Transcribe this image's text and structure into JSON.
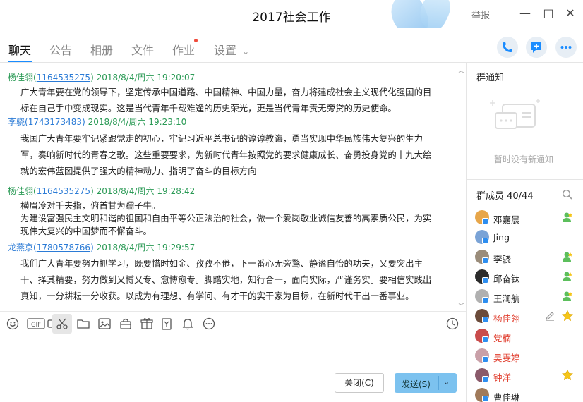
{
  "window": {
    "title": "2017社会工作",
    "report_label": "举报",
    "minimize": "—",
    "maximize": "□",
    "close": "✕"
  },
  "tabs": [
    {
      "label": "聊天",
      "active": true
    },
    {
      "label": "公告"
    },
    {
      "label": "相册"
    },
    {
      "label": "文件"
    },
    {
      "label": "作业",
      "has_dot": true
    },
    {
      "label": "设置"
    }
  ],
  "settings_arrow": "⌄",
  "messages": [
    {
      "sender": "杨佳翎",
      "uid": "1164535275",
      "time": "2018/8/4/周六 19:20:07",
      "color": "#2a9a55",
      "lines": [
        "广大青年要在党的领导下，坚定传承中国道路、中国精神、中国力量，奋力将建成社会主义现代化强国的目",
        "标在自己手中变成现实。这是当代青年千载难逢的历史荣光，更是当代青年责无旁贷的历史使命。"
      ]
    },
    {
      "sender": "李骁",
      "uid": "1743173483",
      "time": "2018/8/4/周六 19:23:10",
      "color": "#2b7bd6",
      "lines": [
        "我国广大青年要牢记紧跟党走的初心，牢记习近平总书记的谆谆教诲，勇当实现中华民族伟大复兴的生力",
        "军，奏响新时代的青春之歌。这些重要要求，为新时代青年按照党的要求健康成长、奋勇投身党的十九大绘",
        "就的宏伟蓝图提供了强大的精神动力、指明了奋斗的目标方向"
      ]
    },
    {
      "sender": "杨佳翎",
      "uid": "1164535275",
      "time": "2018/8/4/周六 19:28:42",
      "color": "#2a9a55",
      "lines": [
        "横眉冷对千夫指，俯首甘为孺子牛。",
        "为建设富强民主文明和谐的祖国和自由平等公正法治的社会，做一个爱岗敬业诚信友善的高素质公民，为实",
        "现伟大复兴的中国梦而不懈奋斗。"
      ]
    },
    {
      "sender": "龙燕京",
      "uid": "1780578766",
      "time": "2018/8/4/周六 19:29:57",
      "color": "#2b7bd6",
      "lines": [
        "我们广大青年要努力抓学习，既要惜时如金、孜孜不倦，下一番心无旁骛、静谧自怡的功夫，又要突出主",
        "干、择其精要，努力做到又博又专、愈博愈专。脚踏实地，知行合一，面向实际，严谨务实。要相信实践出",
        "真知，一分耕耘一分收获。以成为有理想、有学问、有才干的实干家为目标，在新时代干出一番事业。"
      ]
    }
  ],
  "toolbar_icons": [
    "emoji-icon",
    "gif-icon",
    "video-icon",
    "scissors-icon",
    "folder-icon",
    "image-icon",
    "bag-icon",
    "gift-icon",
    "note-icon",
    "bell-icon",
    "more-icon",
    "history-icon"
  ],
  "buttons": {
    "close": "关闭(C)",
    "send": "发送(S)",
    "send_arrow": "⌄"
  },
  "notice": {
    "title": "群通知",
    "empty": "暂时没有新通知"
  },
  "members_panel": {
    "title": "群成员 40/44"
  },
  "members": [
    {
      "name": "邓嘉晨",
      "red": false,
      "badge": "green",
      "avatar_color": "#e7a64a"
    },
    {
      "name": "Jing",
      "red": false,
      "badge": "none",
      "avatar_color": "#7aa3d6"
    },
    {
      "name": "李骁",
      "red": false,
      "badge": "green",
      "avatar_color": "#9a8c7a"
    },
    {
      "name": "邱奋钛",
      "red": false,
      "badge": "green",
      "avatar_color": "#2c2c2c"
    },
    {
      "name": "王润航",
      "red": false,
      "badge": "green",
      "avatar_color": "#b0b0b0"
    },
    {
      "name": "杨佳翎",
      "red": true,
      "badge": "star",
      "edit": true,
      "avatar_color": "#6b4b3a"
    },
    {
      "name": "党楠",
      "red": true,
      "badge": "none",
      "avatar_color": "#c94c4c"
    },
    {
      "name": "吴雯婷",
      "red": true,
      "badge": "none",
      "avatar_color": "#c9a0a8"
    },
    {
      "name": "钟洋",
      "red": true,
      "badge": "star",
      "avatar_color": "#8a5a6a"
    },
    {
      "name": "曹佳琳",
      "red": false,
      "badge": "none",
      "avatar_color": "#a07a5a"
    }
  ]
}
